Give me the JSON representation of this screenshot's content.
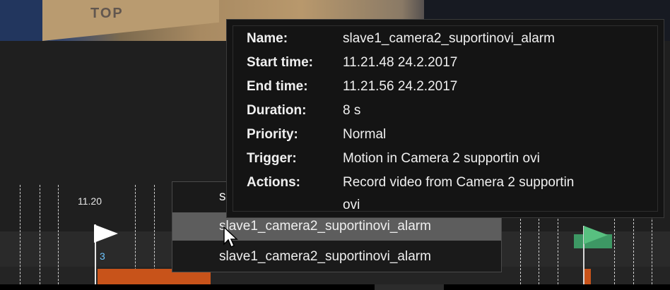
{
  "video": {
    "text": "TOP"
  },
  "timeline": {
    "tick_label": "11.20",
    "marker_number": "3"
  },
  "menu": {
    "items": [
      {
        "label": "s"
      },
      {
        "label": "slave1_camera2_suportinovi_alarm"
      },
      {
        "label": "slave1_camera2_suportinovi_alarm"
      }
    ]
  },
  "tooltip": {
    "fields": [
      {
        "label": "Name:",
        "value": "slave1_camera2_suportinovi_alarm"
      },
      {
        "label": "Start time:",
        "value": "11.21.48  24.2.2017"
      },
      {
        "label": "End time:",
        "value": "11.21.56  24.2.2017"
      },
      {
        "label": "Duration:",
        "value": "8 s"
      },
      {
        "label": "Priority:",
        "value": "Normal"
      },
      {
        "label": "Trigger:",
        "value": "Motion in Camera 2 supportin ovi"
      },
      {
        "label": "Actions:",
        "value": "Record video from Camera 2 supportin",
        "value2": "ovi"
      }
    ]
  },
  "colors": {
    "event_bar": "#c8531a",
    "bookmark_flag": "#58c080",
    "marker_number": "#6ec6ff"
  }
}
